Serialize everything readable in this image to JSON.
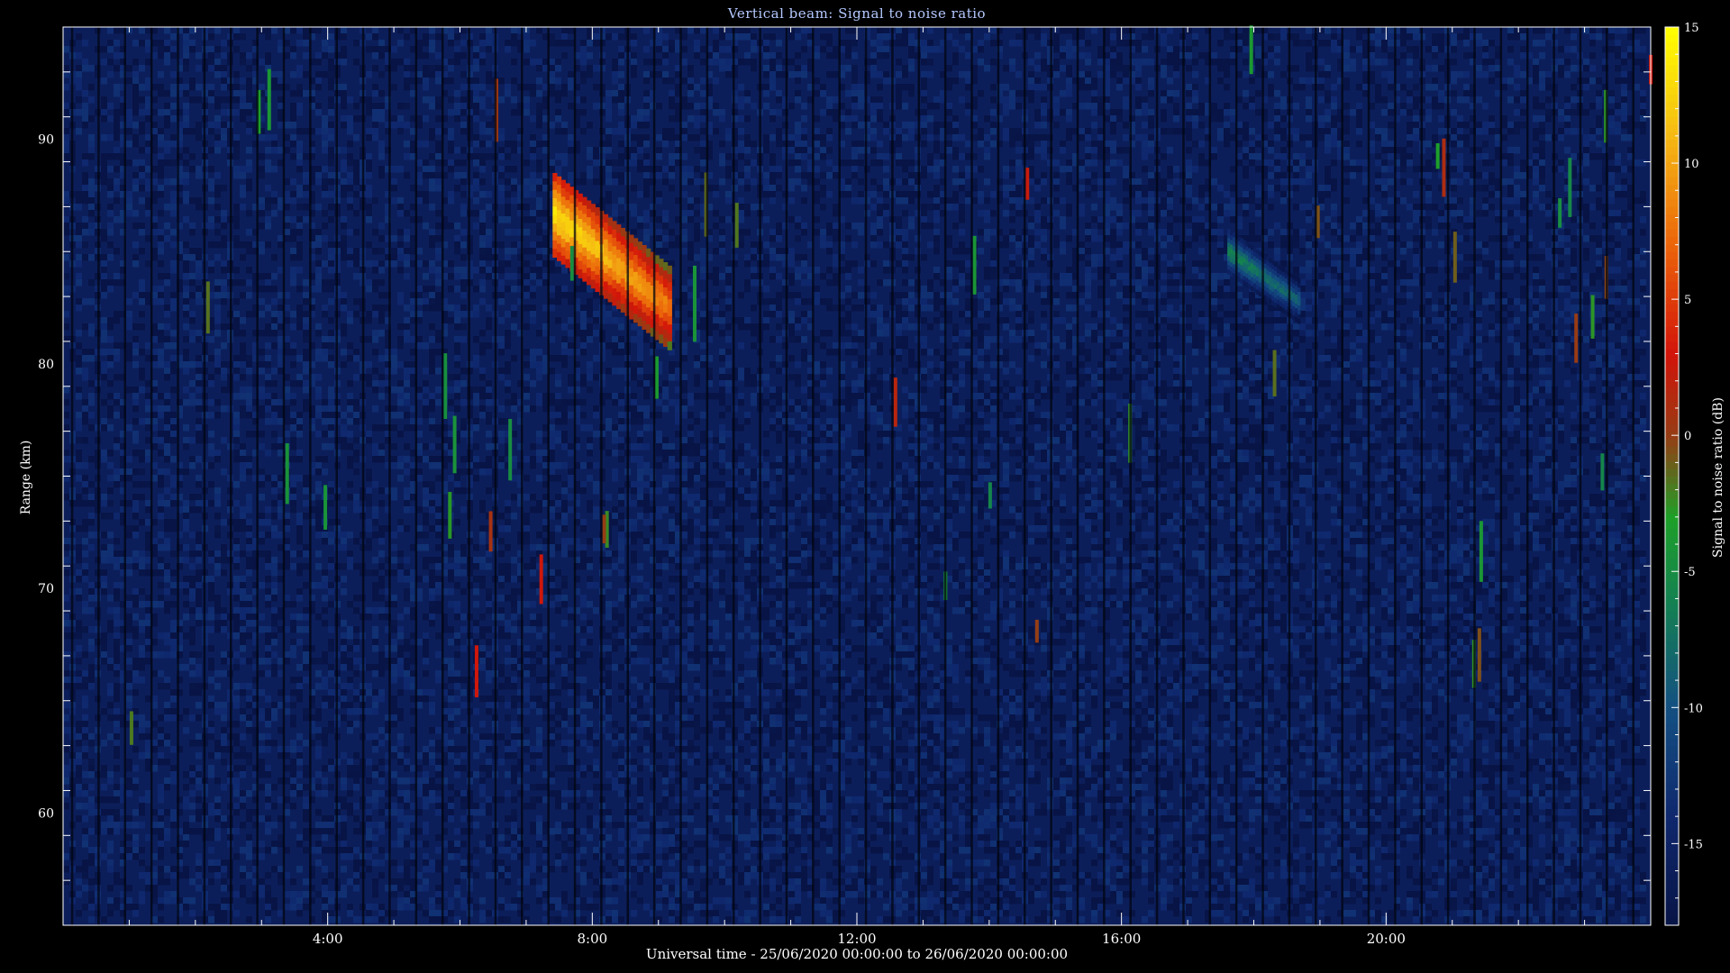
{
  "title": "Vertical beam: Signal to noise ratio",
  "chart_data": {
    "type": "heatmap",
    "title": "Vertical beam: Signal to noise ratio",
    "xlabel": "Universal time - 25/06/2020 00:00:00 to 26/06/2020 00:00:00",
    "ylabel": "Range (km)",
    "x_range_hours": [
      0,
      24
    ],
    "x_ticks": [
      {
        "value": 4,
        "label": "4:00"
      },
      {
        "value": 8,
        "label": "8:00"
      },
      {
        "value": 12,
        "label": "12:00"
      },
      {
        "value": 16,
        "label": "16:00"
      },
      {
        "value": 20,
        "label": "20:00"
      }
    ],
    "ylim": [
      55,
      95
    ],
    "y_ticks": [
      {
        "value": 60,
        "label": "60"
      },
      {
        "value": 70,
        "label": "70"
      },
      {
        "value": 80,
        "label": "80"
      },
      {
        "value": 90,
        "label": "90"
      }
    ],
    "colorbar": {
      "label": "Signal to noise ratio (dB)",
      "range": [
        -18,
        15
      ],
      "ticks": [
        {
          "value": 15,
          "label": "15"
        },
        {
          "value": 10,
          "label": "10"
        },
        {
          "value": 5,
          "label": "5"
        },
        {
          "value": 0,
          "label": "0"
        },
        {
          "value": -5,
          "label": "-5"
        },
        {
          "value": -10,
          "label": "-10"
        },
        {
          "value": -15,
          "label": "-15"
        }
      ]
    },
    "background_snr_db": -16,
    "echo_regions": [
      {
        "t_start": 7.4,
        "t_end": 9.2,
        "range_top": 88.5,
        "range_bottom": 81,
        "peak_snr_db": 14
      },
      {
        "t_start": 17.6,
        "t_end": 18.7,
        "range_top": 86,
        "range_bottom": 82,
        "peak_snr_db": -5
      }
    ]
  }
}
